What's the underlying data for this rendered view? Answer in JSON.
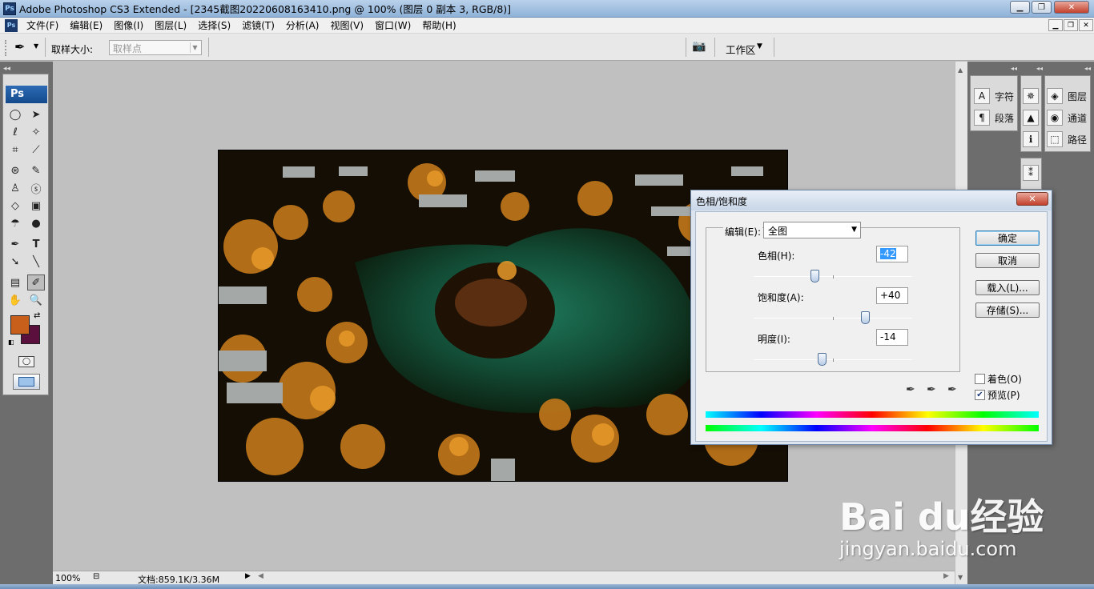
{
  "window": {
    "title": "Adobe Photoshop CS3 Extended - [2345截图20220608163410.png @ 100% (图层 0 副本 3, RGB/8)]",
    "app_icon": "Ps"
  },
  "menu": [
    "文件(F)",
    "编辑(E)",
    "图像(I)",
    "图层(L)",
    "选择(S)",
    "滤镜(T)",
    "分析(A)",
    "视图(V)",
    "窗口(W)",
    "帮助(H)"
  ],
  "options": {
    "sample_size_label": "取样大小:",
    "sample_size_value": "取样点",
    "workspace_label": "工作区"
  },
  "toolbox": {
    "logo": "Ps",
    "foreground_color": "#c8601c",
    "background_color": "#5a0f3c"
  },
  "panels": {
    "character": "字符",
    "paragraph": "段落",
    "layers": "图层",
    "channels": "通道",
    "paths": "路径"
  },
  "status": {
    "zoom": "100%",
    "doc": "文档:859.1K/3.36M"
  },
  "dialog": {
    "title": "色相/饱和度",
    "edit_label": "编辑(E):",
    "edit_value": "全图",
    "hue_label": "色相(H):",
    "hue_value": "-42",
    "hue_level": -42,
    "saturation_label": "饱和度(A):",
    "saturation_value": "+40",
    "saturation_level": 40,
    "lightness_label": "明度(I):",
    "lightness_value": "-14",
    "lightness_level": -14,
    "ok": "确定",
    "cancel": "取消",
    "load": "载入(L)...",
    "save": "存储(S)...",
    "colorize": "着色(O)",
    "colorize_checked": false,
    "preview": "预览(P)",
    "preview_checked": true
  },
  "watermark": {
    "logo": "Bai du经验",
    "url": "jingyan.baidu.com"
  }
}
